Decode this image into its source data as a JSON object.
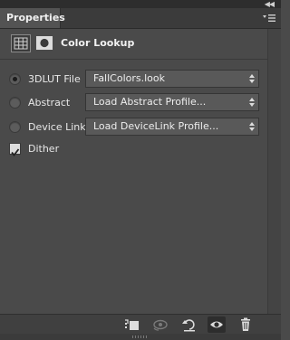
{
  "panel": {
    "tab_label": "Properties",
    "title": "Color Lookup"
  },
  "options": [
    {
      "label": "3DLUT File",
      "value": "FallColors.look",
      "selected": true
    },
    {
      "label": "Abstract",
      "value": "Load Abstract Profile...",
      "selected": false
    },
    {
      "label": "Device Link",
      "value": "Load DeviceLink Profile...",
      "selected": false
    }
  ],
  "dither": {
    "label": "Dither",
    "checked": true
  },
  "icons": {
    "collapse": "double-chevron-right-icon",
    "panel_menu": "panel-menu-icon",
    "adjustment": "adjustment-grid-icon",
    "mask": "layer-mask-icon",
    "bottom": [
      "clip-to-layer-icon",
      "view-previous-state-icon",
      "reset-icon",
      "visibility-eye-icon",
      "trash-icon"
    ]
  },
  "colors": {
    "panel_bg": "#4a4a4a",
    "tab_bg": "#535353",
    "field_bg": "#595959"
  }
}
